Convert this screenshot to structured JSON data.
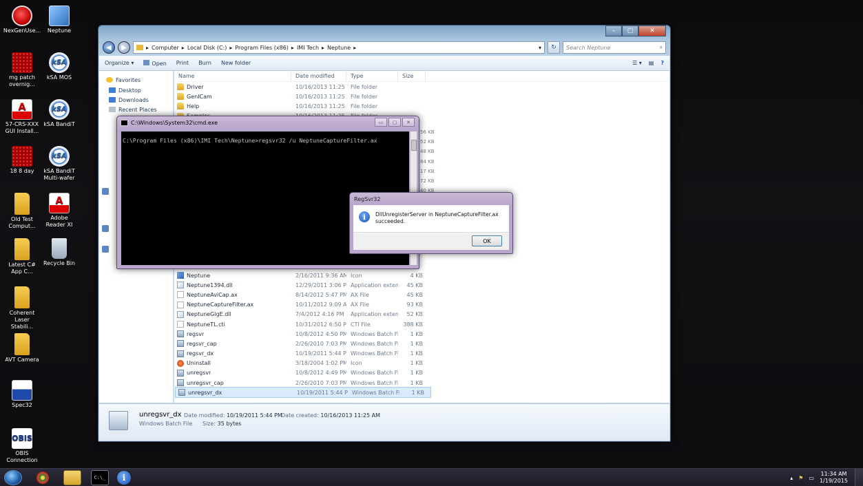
{
  "desktop": {
    "icons": [
      {
        "label": "NexGenUse...",
        "kind": "red-circle"
      },
      {
        "label": "Neptune",
        "kind": "neptune"
      },
      {
        "label": "mg patch overnig...",
        "kind": "grid"
      },
      {
        "label": "kSA MOS",
        "kind": "ksa",
        "glyph": "kSA"
      },
      {
        "label": "57-CRS-XXX GUI Install...",
        "kind": "pdf",
        "glyph": "A"
      },
      {
        "label": "kSA BandiT",
        "kind": "ksa",
        "glyph": "kSA"
      },
      {
        "label": "18 8 day",
        "kind": "grid"
      },
      {
        "label": "kSA BandiT Multi-wafer",
        "kind": "ksa",
        "glyph": "kSA"
      },
      {
        "label": "Old Test Comput...",
        "kind": "folder"
      },
      {
        "label": "Adobe Reader XI",
        "kind": "pdf",
        "glyph": "A"
      },
      {
        "label": "Latest C# App C...",
        "kind": "folder"
      },
      {
        "label": "Recycle Bin",
        "kind": "bin"
      },
      {
        "label": "Coherent Laser Stabili...",
        "kind": "folder"
      },
      {
        "label": "AVT Camera",
        "kind": "folder"
      },
      {
        "label": "Spec32",
        "kind": "spec"
      },
      {
        "label": "OBIS Connection",
        "kind": "obis",
        "glyph": "OBIS"
      }
    ]
  },
  "explorer": {
    "breadcrumb": [
      "Computer",
      "Local Disk (C:)",
      "Program Files (x86)",
      "IMI Tech",
      "Neptune"
    ],
    "search_placeholder": "Search Neptune",
    "toolbar": {
      "organize": "Organize ▾",
      "open": "Open",
      "print": "Print",
      "burn": "Burn",
      "new_folder": "New folder"
    },
    "nav": {
      "favorites": "Favorites",
      "desktop": "Desktop",
      "downloads": "Downloads",
      "recent": "Recent Places"
    },
    "columns": {
      "name": "Name",
      "date": "Date modified",
      "type": "Type",
      "size": "Size"
    },
    "files": [
      {
        "name": "Driver",
        "date": "10/16/2013 11:25 ...",
        "type": "File folder",
        "size": "",
        "icon": "folder"
      },
      {
        "name": "GenICam",
        "date": "10/16/2013 11:25 ...",
        "type": "File folder",
        "size": "",
        "icon": "folder"
      },
      {
        "name": "Help",
        "date": "10/16/2013 11:25 ...",
        "type": "File folder",
        "size": "",
        "icon": "folder"
      },
      {
        "name": "Samples",
        "date": "10/16/2013 11:25 ...",
        "type": "File folder",
        "size": "",
        "icon": "folder"
      }
    ],
    "hidden_sizes": [
      "56 KB",
      "52 KB",
      "48 KB",
      "84 KB",
      "17 KB",
      "72 KB",
      "40 KB"
    ],
    "files_lower": [
      {
        "name": "Neptune",
        "date": "2/16/2011 9:36 AM",
        "type": "Icon",
        "size": "4 KB",
        "icon": "ico"
      },
      {
        "name": "Neptune1394.dll",
        "date": "12/29/2011 3:06 PM",
        "type": "Application extens...",
        "size": "45 KB",
        "icon": "dll"
      },
      {
        "name": "NeptuneAviCap.ax",
        "date": "8/14/2012 5:47 PM",
        "type": "AX File",
        "size": "45 KB",
        "icon": "doc"
      },
      {
        "name": "NeptuneCaptureFilter.ax",
        "date": "10/11/2012 9:09 AM",
        "type": "AX File",
        "size": "93 KB",
        "icon": "doc"
      },
      {
        "name": "NeptuneGigE.dll",
        "date": "7/4/2012 4:16 PM",
        "type": "Application extens...",
        "size": "52 KB",
        "icon": "dll"
      },
      {
        "name": "NeptuneTL.cti",
        "date": "10/31/2012 6:50 PM",
        "type": "CTI File",
        "size": "388 KB",
        "icon": "doc"
      },
      {
        "name": "regsvr",
        "date": "10/8/2012 4:50 PM",
        "type": "Windows Batch File",
        "size": "1 KB",
        "icon": "bat"
      },
      {
        "name": "regsvr_cap",
        "date": "2/26/2010 7:03 PM",
        "type": "Windows Batch File",
        "size": "1 KB",
        "icon": "bat"
      },
      {
        "name": "regsvr_dx",
        "date": "10/19/2011 5:44 PM",
        "type": "Windows Batch File",
        "size": "1 KB",
        "icon": "bat"
      },
      {
        "name": "Uninstall",
        "date": "3/18/2004 1:02 PM",
        "type": "Icon",
        "size": "1 KB",
        "icon": "un"
      },
      {
        "name": "unregsvr",
        "date": "10/8/2012 4:49 PM",
        "type": "Windows Batch File",
        "size": "1 KB",
        "icon": "bat"
      },
      {
        "name": "unregsvr_cap",
        "date": "2/26/2010 7:03 PM",
        "type": "Windows Batch File",
        "size": "1 KB",
        "icon": "bat"
      },
      {
        "name": "unregsvr_dx",
        "date": "10/19/2011 5:44 PM",
        "type": "Windows Batch File",
        "size": "1 KB",
        "icon": "bat",
        "selected": true
      }
    ],
    "details": {
      "name": "unregsvr_dx",
      "type": "Windows Batch File",
      "date_modified_label": "Date modified:",
      "date_modified": "10/19/2011 5:44 PM",
      "size_label": "Size:",
      "size": "35 bytes",
      "date_created_label": "Date created:",
      "date_created": "10/16/2013 11:25 AM"
    }
  },
  "cmd": {
    "title": "C:\\Windows\\System32\\cmd.exe",
    "line": "C:\\Program Files (x86)\\IMI Tech\\Neptune>regsvr32 /u NeptuneCaptureFilter.ax"
  },
  "dialog": {
    "title": "RegSvr32",
    "message": "DllUnregisterServer in NeptuneCaptureFilter.ax succeeded.",
    "ok": "OK"
  },
  "taskbar": {
    "cmd_glyph": "C:\\_",
    "info_glyph": "i",
    "time": "11:34 AM",
    "date": "1/19/2015"
  }
}
